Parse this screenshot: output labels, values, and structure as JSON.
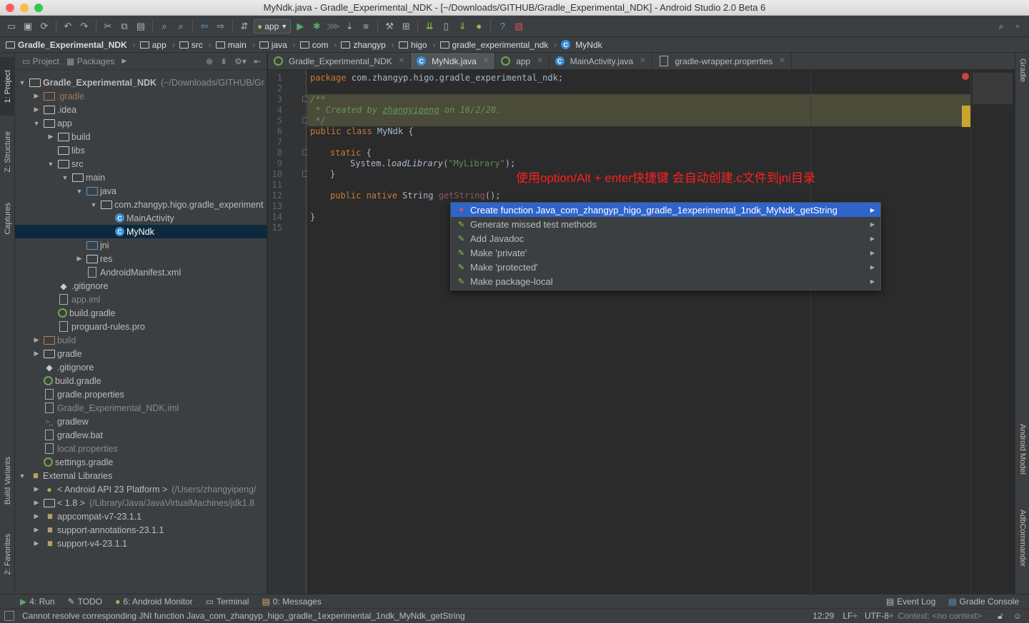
{
  "window": {
    "title": "MyNdk.java - Gradle_Experimental_NDK - [~/Downloads/GITHUB/Gradle_Experimental_NDK] - Android Studio 2.0 Beta 6",
    "traffic_colors": [
      "#fc605c",
      "#fdbc40",
      "#34c84a"
    ]
  },
  "toolbar": {
    "run_config": "app"
  },
  "breadcrumbs": [
    "Gradle_Experimental_NDK",
    "app",
    "src",
    "main",
    "java",
    "com",
    "zhangyp",
    "higo",
    "gradle_experimental_ndk",
    "MyNdk"
  ],
  "left_tools": {
    "project": "1: Project",
    "structure": "Z: Structure",
    "captures": "Captures",
    "build_variants": "Build Variants",
    "favorites": "2: Favorites"
  },
  "right_tools": {
    "gradle": "Gradle",
    "android_model": "Android Model",
    "adb": "AdbCommander"
  },
  "project_panel": {
    "tab_project": "Project",
    "tab_packages": "Packages",
    "tree": [
      {
        "label": "Gradle_Experimental_NDK",
        "suffix": "(~/Downloads/GITHUB/Gr",
        "depth": 0,
        "arrow": "▼",
        "icon": "folder",
        "bold": true
      },
      {
        "label": ".gradle",
        "depth": 1,
        "arrow": "▶",
        "icon": "folder-orange",
        "dim": true
      },
      {
        "label": ".idea",
        "depth": 1,
        "arrow": "▶",
        "icon": "folder"
      },
      {
        "label": "app",
        "depth": 1,
        "arrow": "▼",
        "icon": "folder"
      },
      {
        "label": "build",
        "depth": 2,
        "arrow": "▶",
        "icon": "folder"
      },
      {
        "label": "libs",
        "depth": 2,
        "arrow": "",
        "icon": "folder"
      },
      {
        "label": "src",
        "depth": 2,
        "arrow": "▼",
        "icon": "folder"
      },
      {
        "label": "main",
        "depth": 3,
        "arrow": "▼",
        "icon": "folder"
      },
      {
        "label": "java",
        "depth": 4,
        "arrow": "▼",
        "icon": "folder-blue"
      },
      {
        "label": "com.zhangyp.higo.gradle_experiment",
        "depth": 5,
        "arrow": "▼",
        "icon": "folder"
      },
      {
        "label": "MainActivity",
        "depth": 6,
        "arrow": "",
        "icon": "class"
      },
      {
        "label": "MyNdk",
        "depth": 6,
        "arrow": "",
        "icon": "class",
        "selected": true
      },
      {
        "label": "jni",
        "depth": 4,
        "arrow": "",
        "icon": "folder-blue"
      },
      {
        "label": "res",
        "depth": 4,
        "arrow": "▶",
        "icon": "folder"
      },
      {
        "label": "AndroidManifest.xml",
        "depth": 4,
        "arrow": "",
        "icon": "file"
      },
      {
        "label": ".gitignore",
        "depth": 2,
        "arrow": "",
        "icon": "git"
      },
      {
        "label": "app.iml",
        "depth": 2,
        "arrow": "",
        "icon": "file",
        "muted": true
      },
      {
        "label": "build.gradle",
        "depth": 2,
        "arrow": "",
        "icon": "gradle"
      },
      {
        "label": "proguard-rules.pro",
        "depth": 2,
        "arrow": "",
        "icon": "file"
      },
      {
        "label": "build",
        "depth": 1,
        "arrow": "▶",
        "icon": "folder-orange",
        "muted": true
      },
      {
        "label": "gradle",
        "depth": 1,
        "arrow": "▶",
        "icon": "folder"
      },
      {
        "label": ".gitignore",
        "depth": 1,
        "arrow": "",
        "icon": "git"
      },
      {
        "label": "build.gradle",
        "depth": 1,
        "arrow": "",
        "icon": "gradle"
      },
      {
        "label": "gradle.properties",
        "depth": 1,
        "arrow": "",
        "icon": "file"
      },
      {
        "label": "Gradle_Experimental_NDK.iml",
        "depth": 1,
        "arrow": "",
        "icon": "file",
        "muted": true
      },
      {
        "label": "gradlew",
        "depth": 1,
        "arrow": "",
        "icon": "term"
      },
      {
        "label": "gradlew.bat",
        "depth": 1,
        "arrow": "",
        "icon": "file"
      },
      {
        "label": "local.properties",
        "depth": 1,
        "arrow": "",
        "icon": "file",
        "muted": true
      },
      {
        "label": "settings.gradle",
        "depth": 1,
        "arrow": "",
        "icon": "gradle"
      },
      {
        "label": "External Libraries",
        "depth": 0,
        "arrow": "▼",
        "icon": "lib"
      },
      {
        "label": "< Android API 23 Platform >",
        "suffix": "(/Users/zhangyipeng/",
        "depth": 1,
        "arrow": "▶",
        "icon": "android"
      },
      {
        "label": "< 1.8 >",
        "suffix": "(/Library/Java/JavaVirtualMachines/jdk1.8",
        "depth": 1,
        "arrow": "▶",
        "icon": "folder"
      },
      {
        "label": "appcompat-v7-23.1.1",
        "depth": 1,
        "arrow": "▶",
        "icon": "lib"
      },
      {
        "label": "support-annotations-23.1.1",
        "depth": 1,
        "arrow": "▶",
        "icon": "lib"
      },
      {
        "label": "support-v4-23.1.1",
        "depth": 1,
        "arrow": "▶",
        "icon": "lib"
      }
    ]
  },
  "editor_tabs": [
    {
      "label": "Gradle_Experimental_NDK",
      "icon": "gradle"
    },
    {
      "label": "MyNdk.java",
      "icon": "class",
      "active": true
    },
    {
      "label": "app",
      "icon": "gradle"
    },
    {
      "label": "MainActivity.java",
      "icon": "class"
    },
    {
      "label": "gradle-wrapper.properties",
      "icon": "file"
    }
  ],
  "code": {
    "line_numbers": [
      "1",
      "2",
      "3",
      "4",
      "5",
      "6",
      "7",
      "8",
      "9",
      "10",
      "11",
      "12",
      "13",
      "14",
      "15"
    ],
    "l1_kw": "package",
    "l1_rest": " com.zhangyp.higo.gradle_experimental_ndk;",
    "l3": "/**",
    "l4_a": " * Created by ",
    "l4_b": "zhangyipeng",
    "l4_c": " on 16/2/28.",
    "l5": " */",
    "l6_kw": "public class",
    "l6_rest": " MyNdk {",
    "l8_kw": "static",
    "l8_rest": " {",
    "l9_a": "System.",
    "l9_b": "loadLibrary",
    "l9_c": "(",
    "l9_str": "\"MyLibrary\"",
    "l9_d": ");",
    "l10": "}",
    "l12_kw": "public native",
    "l12_type": " String ",
    "l12_fn": "getString",
    "l12_rest": "();",
    "l14": "}"
  },
  "annotation": "使用option/Alt  + enter快捷键 会自动创建.c文件到jni目录",
  "intention_popup": [
    {
      "label": "Create function Java_com_zhangyp_higo_gradle_1experimental_1ndk_MyNdk_getString",
      "icon": "bulb-red",
      "selected": true
    },
    {
      "label": "Generate missed test methods",
      "icon": "pencil"
    },
    {
      "label": "Add Javadoc",
      "icon": "pencil"
    },
    {
      "label": "Make 'private'",
      "icon": "pencil"
    },
    {
      "label": "Make 'protected'",
      "icon": "pencil"
    },
    {
      "label": "Make package-local",
      "icon": "pencil"
    }
  ],
  "bottom_tools": {
    "run": "4: Run",
    "todo": "TODO",
    "android_monitor": "6: Android Monitor",
    "terminal": "Terminal",
    "messages": "0: Messages",
    "event_log": "Event Log",
    "gradle_console": "Gradle Console"
  },
  "status": {
    "message": "Cannot resolve corresponding JNI function Java_com_zhangyp_higo_gradle_1experimental_1ndk_MyNdk_getString",
    "position": "12:29",
    "line_sep": "LF÷",
    "encoding": "UTF-8÷",
    "context": "Context: <no context>"
  }
}
